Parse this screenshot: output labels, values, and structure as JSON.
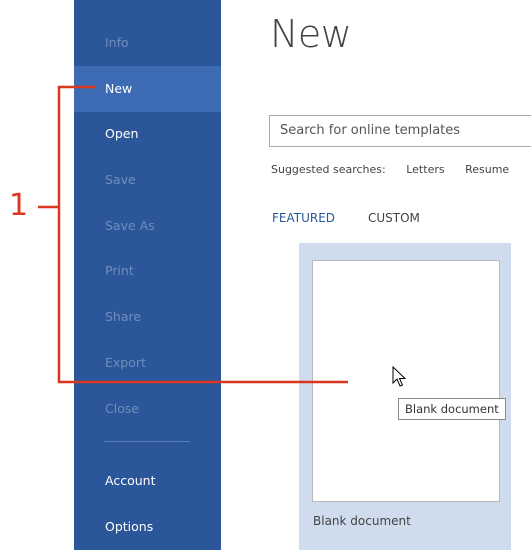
{
  "sidebar": {
    "items": [
      {
        "label": "Info",
        "state": "disabled"
      },
      {
        "label": "New",
        "state": "selected"
      },
      {
        "label": "Open",
        "state": "enabled"
      },
      {
        "label": "Save",
        "state": "disabled"
      },
      {
        "label": "Save As",
        "state": "disabled"
      },
      {
        "label": "Print",
        "state": "disabled"
      },
      {
        "label": "Share",
        "state": "disabled"
      },
      {
        "label": "Export",
        "state": "disabled"
      },
      {
        "label": "Close",
        "state": "disabled"
      },
      {
        "label": "Account",
        "state": "enabled"
      },
      {
        "label": "Options",
        "state": "enabled"
      }
    ]
  },
  "main": {
    "title": "New",
    "search": {
      "placeholder": "Search for online templates"
    },
    "suggested": {
      "label": "Suggested searches:",
      "items": [
        "Letters",
        "Resume"
      ]
    },
    "tabs": [
      {
        "label": "FEATURED",
        "active": true
      },
      {
        "label": "CUSTOM",
        "active": false
      }
    ],
    "templates": [
      {
        "name": "Blank document"
      }
    ],
    "tooltip": "Blank document"
  },
  "callout": {
    "number": "1"
  },
  "colors": {
    "sidebar_bg": "#2b579a",
    "sidebar_selected": "#3d6cb4",
    "callout": "#d9371f",
    "template_highlight": "#cfdcee"
  }
}
